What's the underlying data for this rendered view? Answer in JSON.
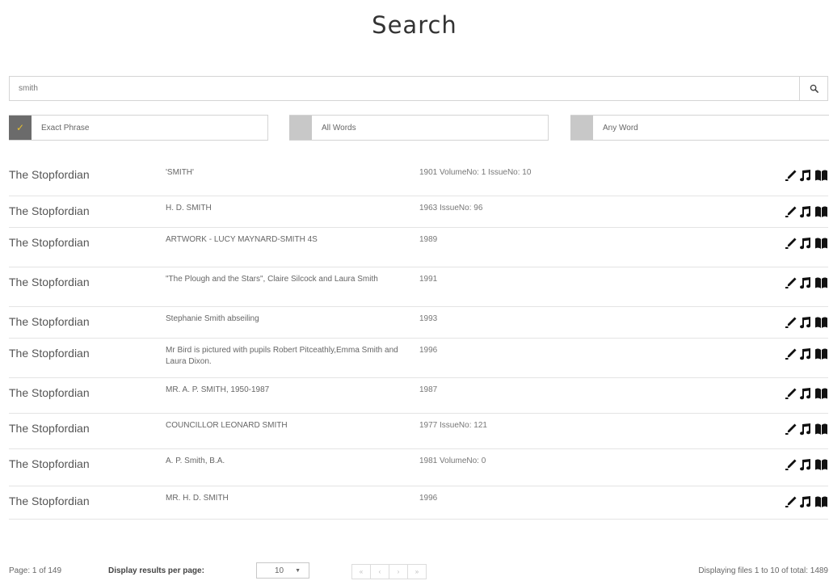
{
  "page": {
    "title": "Search"
  },
  "search": {
    "value": "smith",
    "icon": "search-icon"
  },
  "options": [
    {
      "label": "Exact Phrase",
      "checked": true
    },
    {
      "label": "All Words",
      "checked": false
    },
    {
      "label": "Any Word",
      "checked": false
    }
  ],
  "results": [
    {
      "publication": "The Stopfordian",
      "title": "'SMITH'",
      "date": "1901 VolumeNo: 1 IssueNo: 10"
    },
    {
      "publication": "The Stopfordian",
      "title": "H. D. SMITH",
      "date": "1963 IssueNo: 96"
    },
    {
      "publication": "The Stopfordian",
      "title": "ARTWORK - LUCY MAYNARD-SMITH 4S",
      "date": "1989"
    },
    {
      "publication": "The Stopfordian",
      "title": "\"The Plough and the Stars\", Claire Silcock and Laura Smith",
      "date": "1991"
    },
    {
      "publication": "The Stopfordian",
      "title": "Stephanie Smith abseiling",
      "date": "1993"
    },
    {
      "publication": "The Stopfordian",
      "title": "Mr Bird is pictured with pupils Robert Pitceathly,Emma Smith and Laura Dixon.",
      "date": "1996"
    },
    {
      "publication": "The Stopfordian",
      "title": "MR. A. P. SMITH, 1950-1987",
      "date": "1987"
    },
    {
      "publication": "The Stopfordian",
      "title": "COUNCILLOR LEONARD SMITH",
      "date": "1977 IssueNo: 121"
    },
    {
      "publication": "The Stopfordian",
      "title": "A. P. Smith, B.A.",
      "date": "1981 VolumeNo: 0"
    },
    {
      "publication": "The Stopfordian",
      "title": "MR. H. D. SMITH",
      "date": "1996"
    }
  ],
  "row_icons": [
    "edit-pencil-icon",
    "music-note-icon",
    "open-book-icon"
  ],
  "footer": {
    "page_info": "Page: 1 of 149",
    "per_page_label": "Display results per page:",
    "per_page_value": "10",
    "pager": [
      "«",
      "‹",
      "›",
      "»"
    ],
    "total": "Displaying files 1 to 10 of total: 1489"
  },
  "colors": {
    "checked_box": "#6b6b6b",
    "unchecked_box": "#c8c8c8",
    "tick": "#e8c02e"
  }
}
